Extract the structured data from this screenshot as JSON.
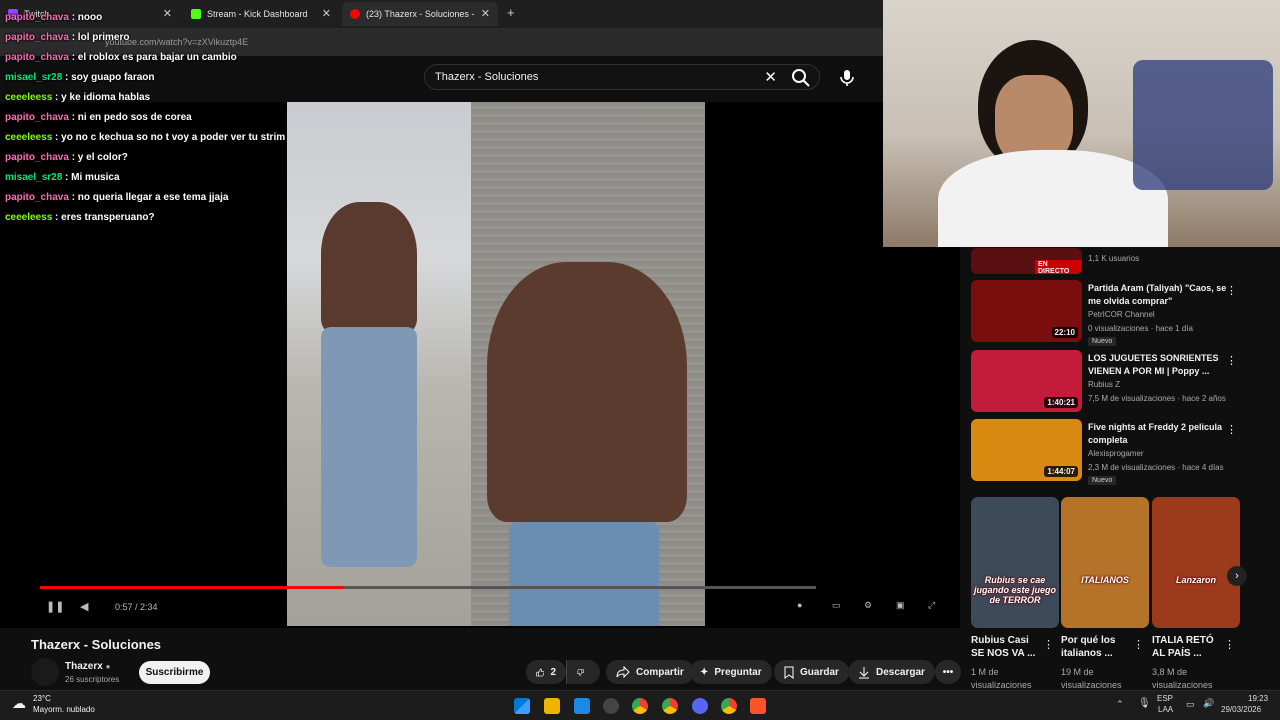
{
  "browser": {
    "tabs": [
      {
        "label": "Twitch"
      },
      {
        "label": "Stream - Kick Dashboard"
      },
      {
        "label": "(23) Thazerx - Soluciones -"
      }
    ],
    "url": "youtube.com/watch?v=zXVikuztp4E"
  },
  "search": {
    "query": "Thazerx - Soluciones"
  },
  "chat": {
    "messages": [
      {
        "user": "papito_chava",
        "text": " : nooo",
        "color": "#ff69b4"
      },
      {
        "user": "papito_chava",
        "text": " : lol primero",
        "color": "#ff69b4"
      },
      {
        "user": "papito_chava",
        "text": " : el roblox es para bajar un cambio",
        "color": "#ff69b4"
      },
      {
        "user": "misael_sr28",
        "text": " : soy guapo faraon",
        "color": "#00e676"
      },
      {
        "user": "ceeeleess",
        "text": " : y ke idioma hablas",
        "color": "#7fff00"
      },
      {
        "user": "papito_chava",
        "text": " : ni en pedo sos de corea",
        "color": "#ff69b4"
      },
      {
        "user": "ceeeleess",
        "text": " : yo no c kechua so no t voy a poder ver tu strim",
        "color": "#7fff00"
      },
      {
        "user": "papito_chava",
        "text": " : y el color?",
        "color": "#ff69b4"
      },
      {
        "user": "misael_sr28",
        "text": " : Mi musica",
        "color": "#00e676"
      },
      {
        "user": "papito_chava",
        "text": " : no queria llegar a ese tema jjaja",
        "color": "#ff69b4"
      },
      {
        "user": "ceeeleess",
        "text": " : eres transperuano?",
        "color": "#7fff00"
      }
    ]
  },
  "player": {
    "time": "0:57 / 2:34",
    "progress": 0.39
  },
  "video": {
    "title": "Thazerx - Soluciones",
    "channel": "Thazerx",
    "subscribers": "26 suscriptores",
    "subscribe_label": "Suscribirme",
    "likes": "2",
    "share_label": "Compartir",
    "ask_label": "Preguntar",
    "save_label": "Guardar",
    "download_label": "Descargar"
  },
  "recommendations": [
    {
      "title": "",
      "channel": "",
      "meta": "1,1 K usuarios",
      "live": "EN DIRECTO"
    },
    {
      "title": "Partida Aram (Taliyah) \"Caos, se me olvida comprar\"",
      "channel": "PetrICOR Channel",
      "meta": "0 visualizaciones · hace 1 día",
      "duration": "22:10",
      "badge": "Nuevo",
      "thumb_color": "#7a0e0e"
    },
    {
      "title": "LOS JUGUETES SONRIENTES VIENEN A POR MI | Poppy ...",
      "channel": "Rubius Z",
      "meta": "7,5 M de visualizaciones · hace 2 años",
      "duration": "1:40:21",
      "thumb_color": "#c21c3a"
    },
    {
      "title": "Five nights at Freddy 2 pelicula completa",
      "channel": "Alexisprogamer",
      "meta": "2,3 M de visualizaciones · hace 4 días",
      "duration": "1:44:07",
      "badge": "Nuevo",
      "thumb_color": "#d98a10"
    }
  ],
  "shorts": [
    {
      "overlay": "Rubius se cae jugando este juego de TERROR",
      "title": "Rubius Casi SE NOS VA ...",
      "views": "1 M de visualizaciones",
      "thumb_color": "#3c4a5a"
    },
    {
      "overlay": "ITALIANOS",
      "title": "Por qué los italianos ...",
      "views": "19 M de visualizaciones",
      "thumb_color": "#b5732a"
    },
    {
      "overlay": "Lanzaron",
      "title": "ITALIA RETÓ AL PAÍS ...",
      "views": "3,8 M de visualizaciones",
      "thumb_color": "#9c3a1c"
    }
  ],
  "taskbar": {
    "weather_temp": "23°C",
    "weather_desc": "Mayorm. nublado",
    "lang1": "ESP",
    "lang2": "LAA",
    "time": "19:23",
    "date": "29/03/2026"
  }
}
